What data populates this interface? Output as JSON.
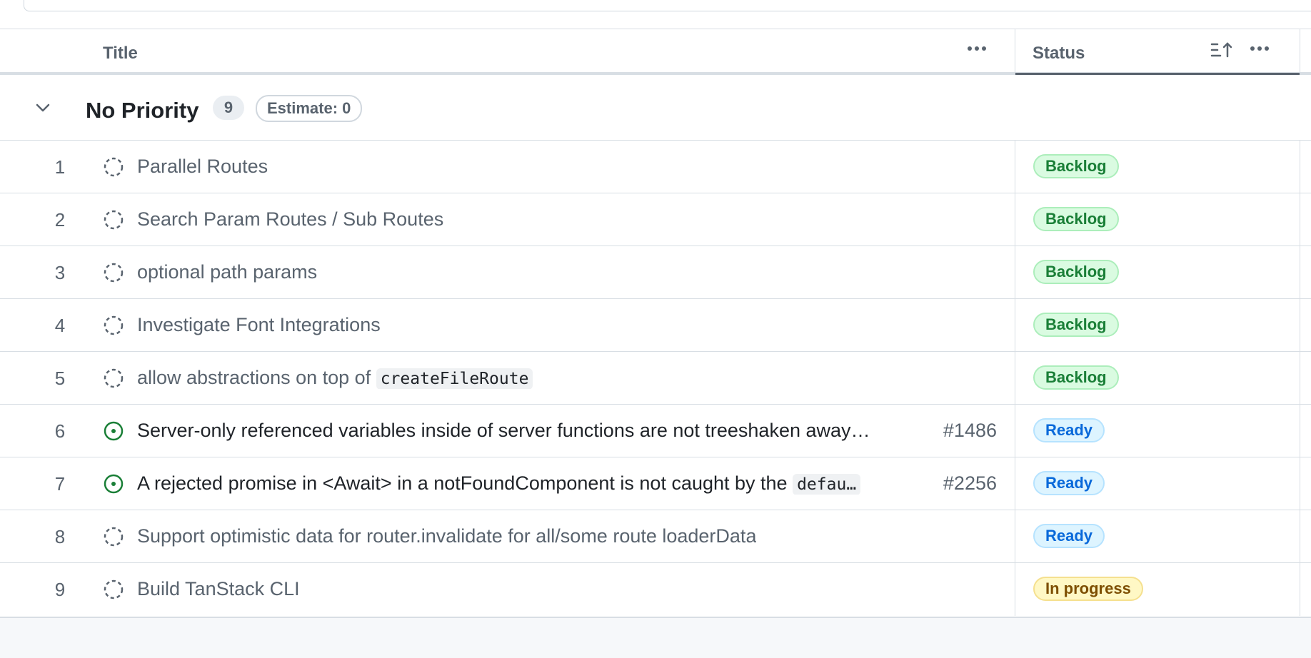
{
  "header": {
    "title_label": "Title",
    "status_label": "Status"
  },
  "group": {
    "title": "No Priority",
    "count": "9",
    "estimate": "Estimate: 0"
  },
  "rows": [
    {
      "num": "1",
      "state": "draft",
      "title": "Parallel Routes",
      "issue": "",
      "status": "Backlog"
    },
    {
      "num": "2",
      "state": "draft",
      "title": "Search Param Routes / Sub Routes",
      "issue": "",
      "status": "Backlog"
    },
    {
      "num": "3",
      "state": "draft",
      "title": "optional path params",
      "issue": "",
      "status": "Backlog"
    },
    {
      "num": "4",
      "state": "draft",
      "title": "Investigate Font Integrations",
      "issue": "",
      "status": "Backlog"
    },
    {
      "num": "5",
      "state": "draft",
      "title": "allow abstractions on top of ",
      "code": "createFileRoute",
      "issue": "",
      "status": "Backlog"
    },
    {
      "num": "6",
      "state": "open",
      "title": "Server-only referenced variables inside of server functions are not treeshaken away…",
      "issue": "#1486",
      "status": "Ready"
    },
    {
      "num": "7",
      "state": "open",
      "title": "A rejected promise in <Await> in a notFoundComponent is not caught by the ",
      "code": "defau…",
      "issue": "#2256",
      "status": "Ready"
    },
    {
      "num": "8",
      "state": "draft",
      "title": "Support optimistic data for router.invalidate for all/some route loaderData",
      "issue": "",
      "status": "Ready"
    },
    {
      "num": "9",
      "state": "draft",
      "title": "Build TanStack CLI",
      "issue": "",
      "status": "In progress"
    }
  ],
  "colors": {
    "backlog": "#1a7f37",
    "ready": "#0969da",
    "in_progress": "#7d4e00",
    "open_issue": "#1a7f37"
  },
  "icons": {
    "draft": "draft-issue-icon",
    "open": "open-issue-icon",
    "sort": "sort-ascending-icon",
    "menu": "kebab-menu-icon",
    "chevron": "chevron-down-icon"
  }
}
